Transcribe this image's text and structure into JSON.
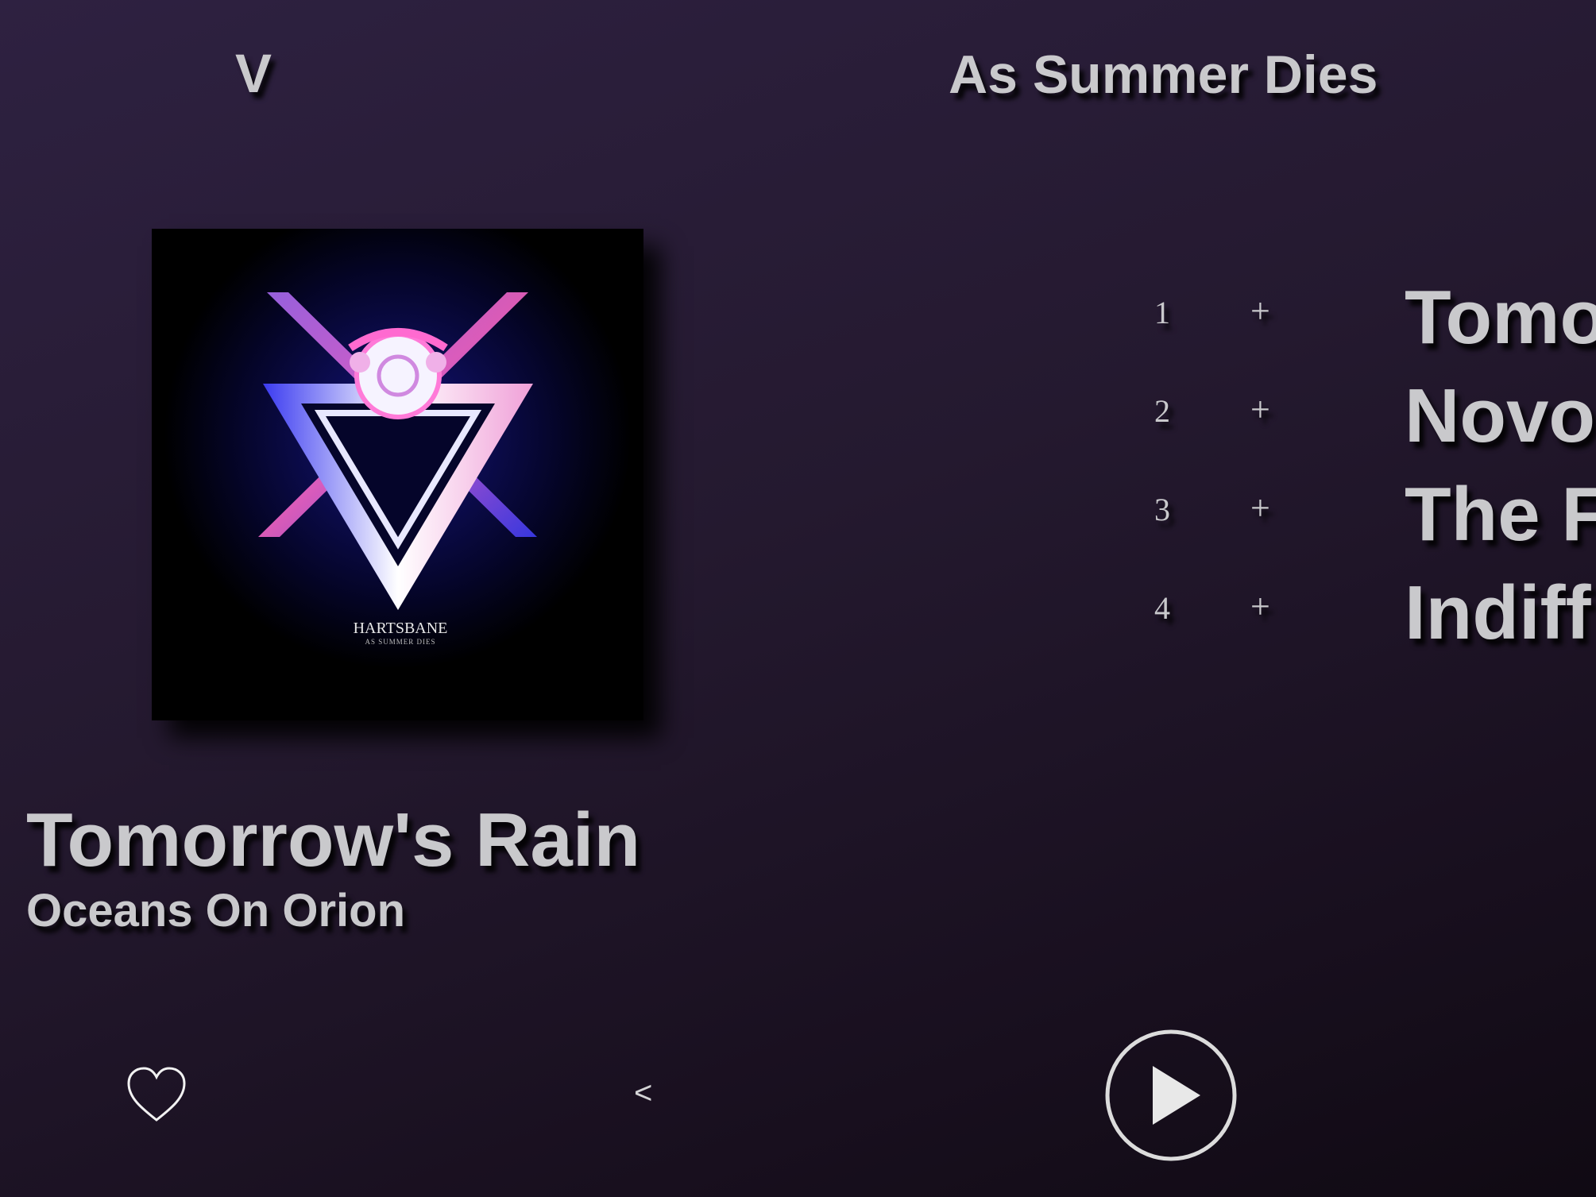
{
  "header": {
    "left_label": "V",
    "album_title": "As Summer Dies"
  },
  "now_playing": {
    "cover_art": {
      "band_name": "HARTSBANE",
      "album_name": "AS SUMMER DIES"
    },
    "track_title": "Tomorrow's Rain",
    "artist": "Oceans On Orion"
  },
  "tracklist": [
    {
      "number": "1",
      "add": "+",
      "title": "Tomo"
    },
    {
      "number": "2",
      "add": "+",
      "title": "Novo"
    },
    {
      "number": "3",
      "add": "+",
      "title": "The F"
    },
    {
      "number": "4",
      "add": "+",
      "title": "Indiff"
    }
  ],
  "controls": {
    "favorite_icon": "heart-outline-icon",
    "back_label": "<",
    "play_icon": "play-circle-icon"
  }
}
